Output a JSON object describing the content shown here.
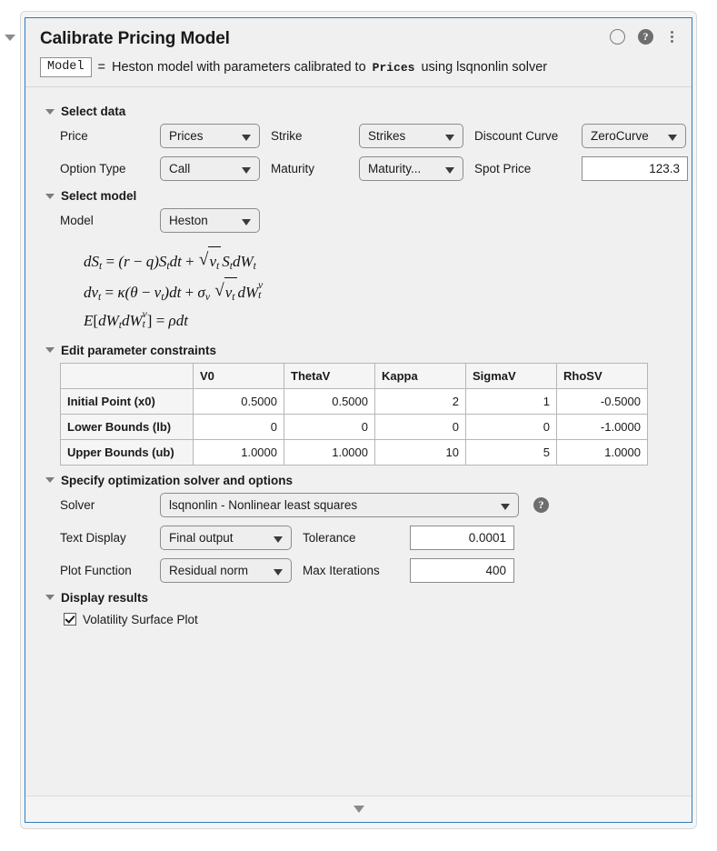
{
  "panel": {
    "title": "Calibrate Pricing Model",
    "summary": {
      "output_var": "Model",
      "equals": "=",
      "text_before": "Heston model with parameters calibrated to",
      "mono_term": "Prices",
      "text_after": "using lsqnonlin solver"
    },
    "header_icons": {
      "status_circle": "circle-outline-icon",
      "help": "?",
      "menu": "kebab-menu-icon"
    },
    "footer_arrow": "chevron-down-icon",
    "left_collapse_arrow": "chevron-down-icon",
    "accent_color": "#2b7ec1",
    "panel_bg": "#f0f0f0"
  },
  "sections": {
    "select_data": {
      "title": "Select data",
      "fields": {
        "price_label": "Price",
        "price_value": "Prices",
        "strike_label": "Strike",
        "strike_value": "Strikes",
        "discount_curve_label": "Discount Curve",
        "discount_curve_value": "ZeroCurve",
        "option_type_label": "Option Type",
        "option_type_value": "Call",
        "maturity_label": "Maturity",
        "maturity_value": "Maturity...",
        "spot_price_label": "Spot Price",
        "spot_price_value": "123.3"
      }
    },
    "select_model": {
      "title": "Select model",
      "model_label": "Model",
      "model_value": "Heston",
      "equations": {
        "eq1": {
          "lhs_d": "d",
          "lhs_S": "S",
          "lhs_sub": "t",
          "eq": "=",
          "open": "(",
          "r": "r",
          "minus": "−",
          "q": "q",
          "close": ")",
          "S2": "S",
          "S2sub": "t",
          "dt": "dt",
          "plus": "+",
          "sqrt_v": "v",
          "sqrt_vsub": "t",
          "S3": "S",
          "S3sub": "t",
          "dW": "dW",
          "dWsub": "t"
        },
        "eq2": {
          "dv": "dv",
          "dvsub": "t",
          "eq": "=",
          "kappa": "κ",
          "open": "(",
          "theta": "θ",
          "minus": "−",
          "v": "v",
          "vsub": "t",
          "close": ")",
          "dt": "dt",
          "plus": "+",
          "sigma": "σ",
          "sigmasub": "v",
          "sqrt_v": "v",
          "sqrt_vsub": "t",
          "dW": "dW",
          "dWsup": "v",
          "dWsub": "t"
        },
        "eq3": {
          "E": "E",
          "ob": "[",
          "dW1": "dW",
          "dW1sub": "t",
          "dW2": "dW",
          "dW2sup": "v",
          "dW2sub": "t",
          "cb": "]",
          "eq": "=",
          "rho": "ρ",
          "dt": "dt"
        }
      }
    },
    "parameter_constraints": {
      "title": "Edit parameter constraints",
      "corner_header": "",
      "columns": [
        "V0",
        "ThetaV",
        "Kappa",
        "SigmaV",
        "RhoSV"
      ],
      "rows": [
        {
          "label": "Initial Point (x0)",
          "values": [
            "0.5000",
            "0.5000",
            "2",
            "1",
            "-0.5000"
          ]
        },
        {
          "label": "Lower Bounds (lb)",
          "values": [
            "0",
            "0",
            "0",
            "0",
            "-1.0000"
          ]
        },
        {
          "label": "Upper Bounds (ub)",
          "values": [
            "1.0000",
            "1.0000",
            "10",
            "5",
            "1.0000"
          ]
        }
      ]
    },
    "solver_options": {
      "title": "Specify optimization solver and options",
      "solver_label": "Solver",
      "solver_value": "lsqnonlin - Nonlinear least squares",
      "solver_help": "?",
      "text_display_label": "Text Display",
      "text_display_value": "Final output",
      "tolerance_label": "Tolerance",
      "tolerance_value": "0.0001",
      "plot_function_label": "Plot Function",
      "plot_function_value": "Residual norm",
      "max_iterations_label": "Max Iterations",
      "max_iterations_value": "400"
    },
    "display_results": {
      "title": "Display results",
      "checkbox_label": "Volatility Surface Plot",
      "checkbox_checked": true
    }
  }
}
